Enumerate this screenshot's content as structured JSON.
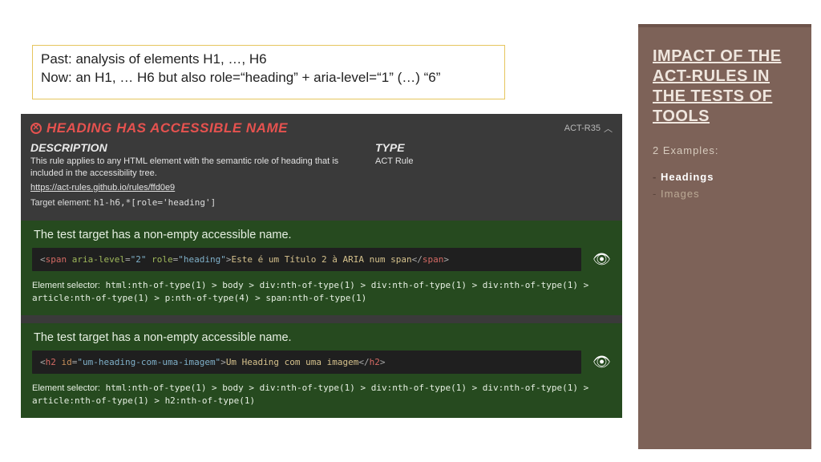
{
  "note": {
    "line1": "Past: analysis of elements H1, …, H6",
    "line2": "Now: an H1, … H6 but also role=“heading” + aria-level=“1” (…) “6”"
  },
  "rule": {
    "title": "HEADING HAS ACCESSIBLE NAME",
    "id": "ACT-R35",
    "description_label": "DESCRIPTION",
    "description": "This rule applies to any HTML element with the semantic role of heading that is included in the accessibility tree.",
    "link": "https://act-rules.github.io/rules/ffd0e9",
    "target_label": "Target element:",
    "target_value": "h1-h6,*[role='heading']",
    "type_label": "TYPE",
    "type_value": "ACT Rule"
  },
  "results": [
    {
      "title": "The test target has a non-empty accessible name.",
      "code": {
        "open_tag": "span",
        "attr1_name": "aria-level",
        "attr1_val": "\"2\"",
        "attr2_name": "role",
        "attr2_val": "\"heading\"",
        "text": "Este é um Título 2 à ARIA num span",
        "close_tag": "span"
      },
      "selector_label": "Element selector:",
      "selector": "html:nth-of-type(1) > body > div:nth-of-type(1) > div:nth-of-type(1) > div:nth-of-type(1) > article:nth-of-type(1) > p:nth-of-type(4) > span:nth-of-type(1)"
    },
    {
      "title": "The test target has a non-empty accessible name.",
      "code": {
        "open_tag": "h2",
        "attr1_name": "id",
        "attr1_val": "\"um-heading-com-uma-imagem\"",
        "text": "Um Heading com uma imagem",
        "close_tag": "h2"
      },
      "selector_label": "Element selector:",
      "selector": "html:nth-of-type(1) > body > div:nth-of-type(1) > div:nth-of-type(1) > div:nth-of-type(1) > article:nth-of-type(1) > h2:nth-of-type(1)"
    }
  ],
  "sidebar": {
    "title": "IMPACT OF THE ACT-RULES IN THE TESTS OF TOOLS",
    "subtitle": "2 Examples:",
    "items": [
      {
        "label": "Headings",
        "active": true
      },
      {
        "label": "Images",
        "active": false
      }
    ]
  }
}
